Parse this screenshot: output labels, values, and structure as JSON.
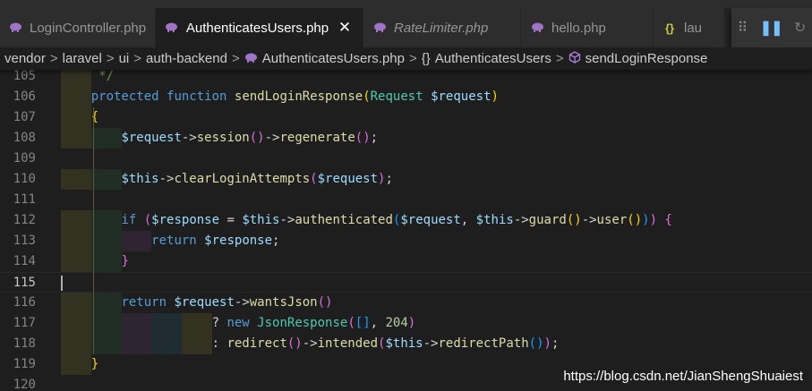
{
  "tabs": [
    {
      "label": "LoginController.php",
      "icon": "php-elephant-icon",
      "active": false,
      "italic": false
    },
    {
      "label": "AuthenticatesUsers.php",
      "icon": "php-elephant-icon",
      "active": true,
      "italic": false
    },
    {
      "label": "RateLimiter.php",
      "icon": "php-elephant-icon",
      "active": false,
      "italic": true
    },
    {
      "label": "hello.php",
      "icon": "php-elephant-icon",
      "active": false,
      "italic": false
    },
    {
      "label": "lau",
      "icon": "json-braces-icon",
      "active": false,
      "italic": false
    }
  ],
  "tab_close_glyph": "✕",
  "debug_toolbar": {
    "grip": "⠿",
    "pause": "❚❚",
    "restart": "↻"
  },
  "breadcrumb": {
    "items": [
      "vendor",
      "laravel",
      "ui",
      "auth-backend"
    ],
    "file": "AuthenticatesUsers.php",
    "namespace_glyph": "{}",
    "class": "AuthenticatesUsers",
    "method": "sendLoginResponse",
    "separator": ">"
  },
  "editor": {
    "current_line": 115,
    "lines": [
      {
        "n": "105",
        "segs": [
          [
            "op",
            "    "
          ],
          [
            "cm",
            " */"
          ]
        ]
      },
      {
        "n": "106",
        "segs": [
          [
            "op",
            "    "
          ],
          [
            "kw",
            "protected"
          ],
          [
            "op",
            " "
          ],
          [
            "kw",
            "function"
          ],
          [
            "op",
            " "
          ],
          [
            "fn",
            "sendLoginResponse"
          ],
          [
            "b1",
            "("
          ],
          [
            "cls",
            "Request"
          ],
          [
            "op",
            " "
          ],
          [
            "var",
            "$request"
          ],
          [
            "b1",
            ")"
          ]
        ]
      },
      {
        "n": "107",
        "segs": [
          [
            "op",
            "    "
          ],
          [
            "b1",
            "{"
          ]
        ]
      },
      {
        "n": "108",
        "segs": [
          [
            "op",
            "        "
          ],
          [
            "var",
            "$request"
          ],
          [
            "op",
            "->"
          ],
          [
            "fn",
            "session"
          ],
          [
            "b2",
            "()"
          ],
          [
            "op",
            "->"
          ],
          [
            "fn",
            "regenerate"
          ],
          [
            "b2",
            "()"
          ],
          [
            "op",
            ";"
          ]
        ]
      },
      {
        "n": "109",
        "segs": []
      },
      {
        "n": "110",
        "segs": [
          [
            "op",
            "        "
          ],
          [
            "var",
            "$this"
          ],
          [
            "op",
            "->"
          ],
          [
            "fn",
            "clearLoginAttempts"
          ],
          [
            "b2",
            "("
          ],
          [
            "var",
            "$request"
          ],
          [
            "b2",
            ")"
          ],
          [
            "op",
            ";"
          ]
        ]
      },
      {
        "n": "111",
        "segs": []
      },
      {
        "n": "112",
        "segs": [
          [
            "op",
            "        "
          ],
          [
            "kw",
            "if"
          ],
          [
            "op",
            " "
          ],
          [
            "b2",
            "("
          ],
          [
            "var",
            "$response"
          ],
          [
            "op",
            " = "
          ],
          [
            "var",
            "$this"
          ],
          [
            "op",
            "->"
          ],
          [
            "fn",
            "authenticated"
          ],
          [
            "b3",
            "("
          ],
          [
            "var",
            "$request"
          ],
          [
            "op",
            ", "
          ],
          [
            "var",
            "$this"
          ],
          [
            "op",
            "->"
          ],
          [
            "fn",
            "guard"
          ],
          [
            "b1",
            "()"
          ],
          [
            "op",
            "->"
          ],
          [
            "fn",
            "user"
          ],
          [
            "b1",
            "()"
          ],
          [
            "b3",
            ")"
          ],
          [
            "b2",
            ")"
          ],
          [
            "op",
            " "
          ],
          [
            "b2",
            "{"
          ]
        ]
      },
      {
        "n": "113",
        "segs": [
          [
            "op",
            "            "
          ],
          [
            "kw",
            "return"
          ],
          [
            "op",
            " "
          ],
          [
            "var",
            "$response"
          ],
          [
            "op",
            ";"
          ]
        ]
      },
      {
        "n": "114",
        "segs": [
          [
            "op",
            "        "
          ],
          [
            "b2",
            "}"
          ]
        ]
      },
      {
        "n": "115",
        "segs": []
      },
      {
        "n": "116",
        "segs": [
          [
            "op",
            "        "
          ],
          [
            "kw",
            "return"
          ],
          [
            "op",
            " "
          ],
          [
            "var",
            "$request"
          ],
          [
            "op",
            "->"
          ],
          [
            "fn",
            "wantsJson"
          ],
          [
            "b2",
            "()"
          ]
        ]
      },
      {
        "n": "117",
        "segs": [
          [
            "op",
            "                    ? "
          ],
          [
            "kw",
            "new"
          ],
          [
            "op",
            " "
          ],
          [
            "cls",
            "JsonResponse"
          ],
          [
            "b2",
            "("
          ],
          [
            "b3",
            "[]"
          ],
          [
            "op",
            ", "
          ],
          [
            "num",
            "204"
          ],
          [
            "b2",
            ")"
          ]
        ]
      },
      {
        "n": "118",
        "segs": [
          [
            "op",
            "                    : "
          ],
          [
            "fn",
            "redirect"
          ],
          [
            "b2",
            "()"
          ],
          [
            "op",
            "->"
          ],
          [
            "fn",
            "intended"
          ],
          [
            "b2",
            "("
          ],
          [
            "var",
            "$this"
          ],
          [
            "op",
            "->"
          ],
          [
            "fn",
            "redirectPath"
          ],
          [
            "b3",
            "()"
          ],
          [
            "b2",
            ")"
          ],
          [
            "op",
            ";"
          ]
        ]
      },
      {
        "n": "119",
        "segs": [
          [
            "op",
            "    "
          ],
          [
            "b1",
            "}"
          ]
        ]
      },
      {
        "n": "120",
        "segs": []
      }
    ]
  },
  "watermark": "https://blog.csdn.net/JianShengShuaiest",
  "colors": {
    "background": "#1e1e1e",
    "tab_inactive": "#2d2d2d",
    "keyword": "#569cd6",
    "function": "#dcdcaa",
    "variable": "#9cdcfe",
    "class": "#4ec9b0",
    "indent_level_1": "#3b3a22",
    "indent_level_2": "#233428",
    "indent_level_3": "#36283a",
    "indent_level_4": "#20313a"
  }
}
